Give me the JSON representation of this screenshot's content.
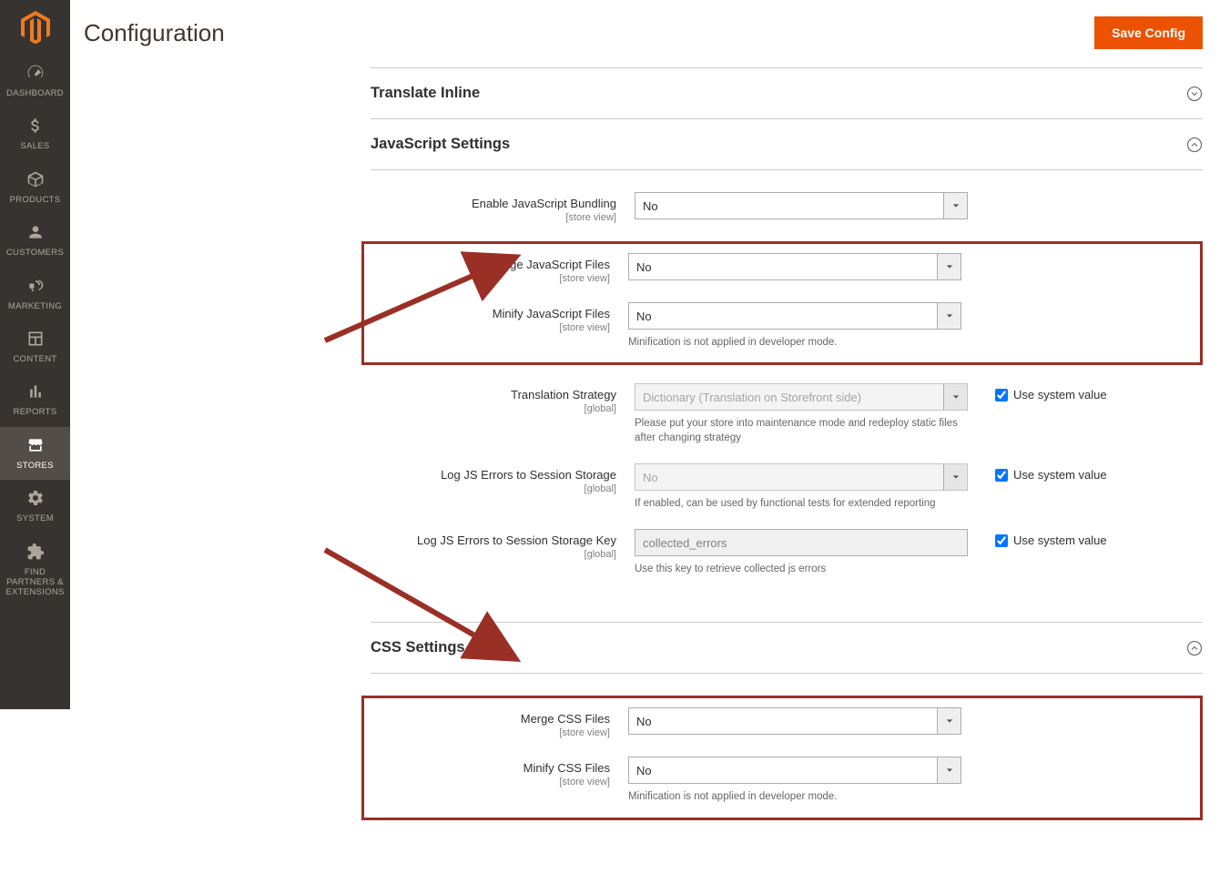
{
  "header": {
    "title": "Configuration",
    "save_button": "Save Config"
  },
  "sidebar": {
    "items": [
      {
        "label": "DASHBOARD"
      },
      {
        "label": "SALES"
      },
      {
        "label": "PRODUCTS"
      },
      {
        "label": "CUSTOMERS"
      },
      {
        "label": "MARKETING"
      },
      {
        "label": "CONTENT"
      },
      {
        "label": "REPORTS"
      },
      {
        "label": "STORES"
      },
      {
        "label": "SYSTEM"
      },
      {
        "label": "FIND PARTNERS & EXTENSIONS"
      }
    ]
  },
  "sections": {
    "translate_inline": {
      "title": "Translate Inline"
    },
    "js_settings": {
      "title": "JavaScript Settings",
      "enable_bundling": {
        "label": "Enable JavaScript Bundling",
        "scope": "[store view]",
        "value": "No"
      },
      "merge_files": {
        "label": "Merge JavaScript Files",
        "scope": "[store view]",
        "value": "No"
      },
      "minify_files": {
        "label": "Minify JavaScript Files",
        "scope": "[store view]",
        "value": "No",
        "note": "Minification is not applied in developer mode."
      },
      "translation_strategy": {
        "label": "Translation Strategy",
        "scope": "[global]",
        "value": "Dictionary (Translation on Storefront side)",
        "note": "Please put your store into maintenance mode and redeploy static files after changing strategy",
        "use_system": "Use system value"
      },
      "log_errors": {
        "label": "Log JS Errors to Session Storage",
        "scope": "[global]",
        "value": "No",
        "note": "If enabled, can be used by functional tests for extended reporting",
        "use_system": "Use system value"
      },
      "log_key": {
        "label": "Log JS Errors to Session Storage Key",
        "scope": "[global]",
        "value": "collected_errors",
        "note": "Use this key to retrieve collected js errors",
        "use_system": "Use system value"
      }
    },
    "css_settings": {
      "title": "CSS Settings",
      "merge_files": {
        "label": "Merge CSS Files",
        "scope": "[store view]",
        "value": "No"
      },
      "minify_files": {
        "label": "Minify CSS Files",
        "scope": "[store view]",
        "value": "No",
        "note": "Minification is not applied in developer mode."
      }
    }
  }
}
